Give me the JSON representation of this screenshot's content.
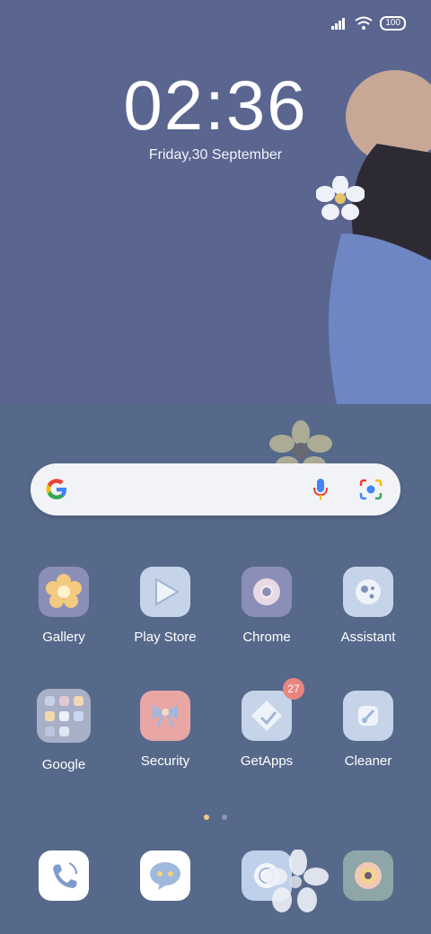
{
  "status_bar": {
    "battery": "100",
    "icons": [
      "signal-icon",
      "wifi-icon",
      "battery-icon"
    ]
  },
  "lockscreen": {
    "time": "02:36",
    "date": "Friday,30 September"
  },
  "search_bar": {
    "icons": [
      "google-logo-icon",
      "microphone-icon",
      "google-lens-icon"
    ]
  },
  "apps_row1": [
    {
      "label": "Gallery",
      "icon": "flower-icon"
    },
    {
      "label": "Play Store",
      "icon": "play-store-icon"
    },
    {
      "label": "Chrome",
      "icon": "chrome-icon"
    },
    {
      "label": "Assistant",
      "icon": "assistant-icon"
    }
  ],
  "apps_row2": [
    {
      "label": "Google",
      "icon": "folder-icon"
    },
    {
      "label": "Security",
      "icon": "bow-icon"
    },
    {
      "label": "GetApps",
      "icon": "getapps-icon",
      "badge": "27"
    },
    {
      "label": "Cleaner",
      "icon": "brush-icon"
    }
  ],
  "page_indicator": {
    "pages": 2,
    "active": 1
  },
  "dock": [
    {
      "icon": "phone-icon"
    },
    {
      "icon": "messages-icon"
    },
    {
      "icon": "browser-icon"
    },
    {
      "icon": "camera-icon"
    }
  ],
  "colors": {
    "accent_badge": "#e8857f",
    "active_dot": "#f3c98b"
  }
}
